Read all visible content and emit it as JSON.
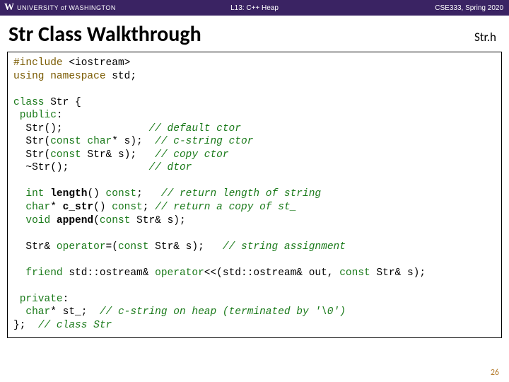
{
  "topbar": {
    "logo_letter": "W",
    "university": "UNIVERSITY of WASHINGTON",
    "center": "L13: C++ Heap",
    "right": "CSE333, Spring 2020"
  },
  "title": "Str Class Walkthrough",
  "file_label": "Str.h",
  "code": {
    "l1a": "#include",
    "l1b": " <iostream>",
    "l2a": "using namespace",
    "l2b": " std;",
    "l4a": "class",
    "l4b": " Str {",
    "l5a": " public",
    "l5b": ":",
    "l6a": "  Str();              ",
    "l6c": "// default ctor",
    "l7a": "  Str(",
    "l7b": "const char",
    "l7c": "* s);  ",
    "l7d": "// c-string ctor",
    "l8a": "  Str(",
    "l8b": "const",
    "l8c": " Str& s);   ",
    "l8d": "// copy ctor",
    "l9a": "  ~Str();             ",
    "l9d": "// dtor",
    "l11a": "  ",
    "l11b": "int",
    "l11c": " ",
    "l11fn": "length",
    "l11d": "() ",
    "l11e": "const",
    "l11f": ";   ",
    "l11g": "// return length of string",
    "l12a": "  ",
    "l12b": "char",
    "l12c": "* ",
    "l12fn": "c_str",
    "l12d": "() ",
    "l12e": "const",
    "l12f": "; ",
    "l12g": "// return a copy of st_",
    "l13a": "  ",
    "l13b": "void",
    "l13c": " ",
    "l13fn": "append",
    "l13d": "(",
    "l13e": "const",
    "l13f": " Str& s);",
    "l15a": "  Str& ",
    "l15b": "operator",
    "l15c": "=(",
    "l15d": "const",
    "l15e": " Str& s);   ",
    "l15g": "// string assignment",
    "l17a": "  ",
    "l17b": "friend",
    "l17c": " std::ostream& ",
    "l17d": "operator",
    "l17e": "<<(std::ostream& out, ",
    "l17f": "const",
    "l17g": " Str& s);",
    "l19a": " private",
    "l19b": ":",
    "l20a": "  ",
    "l20b": "char",
    "l20c": "* st_;  ",
    "l20d": "// c-string on heap (terminated by '\\0')",
    "l21a": "};  ",
    "l21b": "// class Str"
  },
  "page_number": "26"
}
